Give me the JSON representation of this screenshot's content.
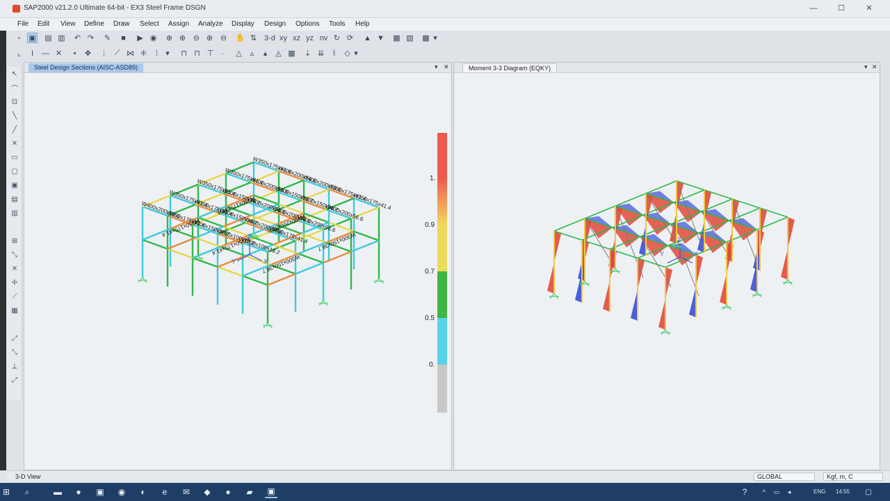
{
  "window": {
    "title": "SAP2000 v21.2.0 Ultimate 64-bit - EX3 Steel Frame DSGN",
    "minimize": "—",
    "maximize": "☐",
    "close": "✕"
  },
  "menu": [
    "File",
    "Edit",
    "View",
    "Define",
    "Draw",
    "Select",
    "Assign",
    "Analyze",
    "Display",
    "Design",
    "Options",
    "Tools",
    "Help"
  ],
  "toolbar1": {
    "labels": {
      "xy": "xy",
      "xz": "xz",
      "yz": "yz",
      "nv": "nv",
      "3d": "3-d"
    }
  },
  "left_pane": {
    "tab_title": "Steel Design Sections  (AISC-ASD89)",
    "dropdown": "▾",
    "close": "✕",
    "section_labels": [
      "W350x175x41.4",
      "W400x200x56.6",
      "W400x200x56.6",
      "W350x175x41.4",
      "W350x175x41.4",
      "W350x175x41.4",
      "W400x200x56.6",
      "W300x150x36.7",
      "W300x150x36.7",
      "W400x200x56.6",
      "W350x175x41.4",
      "W300x150x36.7",
      "W400x200x56.6",
      "W400x200x56.6",
      "W400x200x56.6",
      "W350x175x41.4",
      "W350x175x41.4",
      "W300x150x36.7",
      "W400x200x56.6",
      "W350x175x41.4",
      "W400x200x56.6",
      "W350x175x41.4",
      "W300x150x36.7",
      "W200x100x18.2",
      "W200x100x18.2",
      "W350x175x41.4",
      "W350x175x41.4",
      "W400x200x56.6",
      "W350x175x41.4",
      "W300x150x36.7",
      "W300x150x36.7",
      "W350x175x41.4",
      "W400x200x56.6",
      "W400x200x56.6",
      "W400x200x56.6",
      "W350x175x41.4",
      "W300x150x36.7",
      "W400x200x56.6",
      "W400x200x56.6",
      "W350x175x41.4",
      "W350x175x41.4",
      "W200x100x16.2",
      "W350x175x41.4",
      "W200x100x18.2",
      "W200x100x18.2"
    ],
    "axis_labels": {
      "z": "Z",
      "x": "X",
      "y": "Y"
    }
  },
  "legend": {
    "ticks": [
      "1.",
      "0.9",
      "0.7",
      "0.5",
      "0."
    ],
    "colors": {
      "red": "#ee5a4e",
      "orange": "#f19a56",
      "yellow": "#f0d85a",
      "green": "#3fb543",
      "cyan": "#5ad2e8",
      "gray": "#c8c8c8"
    }
  },
  "right_pane": {
    "tab_title": "Moment 3-3 Diagram  (EQKY)",
    "dropdown": "▾",
    "close": "✕",
    "axis_labels": {
      "z": "Z",
      "x": "X",
      "y": "Y"
    }
  },
  "status": {
    "view": "3-D View",
    "coord_system": "GLOBAL",
    "units": "Kgf, m, C"
  },
  "taskbar": {
    "tray": [
      "ENG",
      "14:55"
    ]
  },
  "colors": {
    "frame_green": "#2fb84a",
    "frame_cyan": "#3ec9dc",
    "frame_orange": "#e88a3a",
    "frame_yellow": "#e6d74a",
    "moment_red": "#e24a3a",
    "moment_blue": "#3a4fd8",
    "moment_yellow": "#f2c640",
    "support_green": "#4fcf6f",
    "gray_frame": "#777777"
  }
}
